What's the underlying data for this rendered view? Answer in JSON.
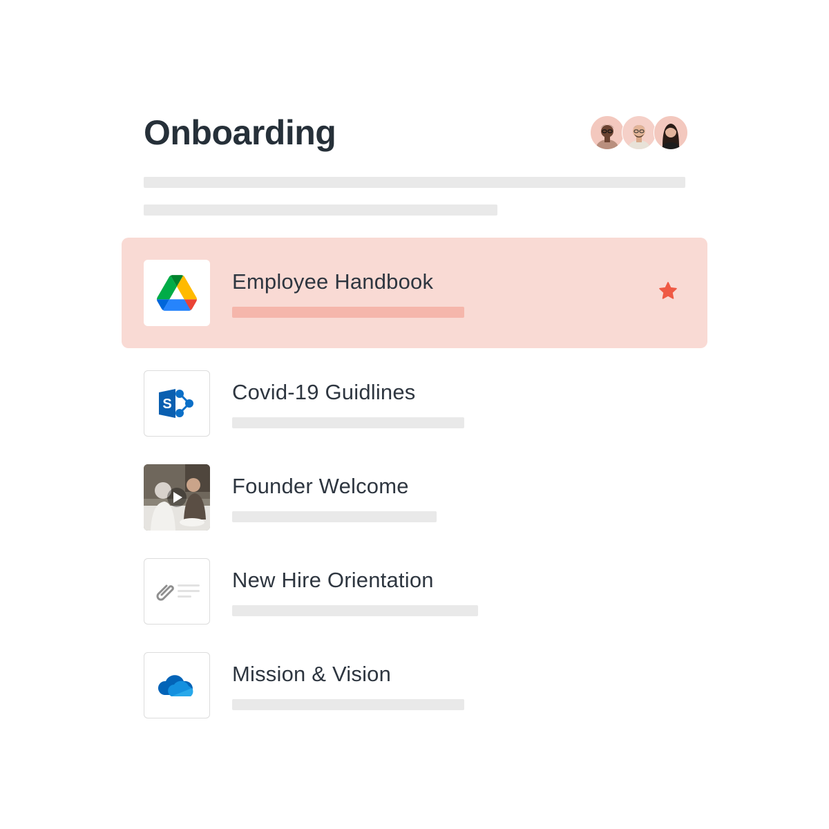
{
  "page": {
    "title": "Onboarding"
  },
  "collaborators": [
    {
      "name": "avatar-1",
      "bg": "#f3c8be"
    },
    {
      "name": "avatar-2",
      "bg": "#f5d0c8"
    },
    {
      "name": "avatar-3",
      "bg": "#f3c8be"
    }
  ],
  "items": [
    {
      "title": "Employee Handbook",
      "icon": "google-drive-icon",
      "starred": true,
      "bar_fraction": 0.4
    },
    {
      "title": "Covid-19 Guidlines",
      "icon": "sharepoint-icon",
      "starred": false
    },
    {
      "title": "Founder Welcome",
      "icon": "video-thumbnail-play-icon",
      "starred": false
    },
    {
      "title": "New Hire Orientation",
      "icon": "attachment-document-icon",
      "starred": false
    },
    {
      "title": "Mission & Vision",
      "icon": "onedrive-cloud-icon",
      "starred": false
    }
  ],
  "colors": {
    "highlight_bg": "#f9dad4",
    "highlight_bar": "#f5b6ab",
    "star": "#ef5a45",
    "skeleton": "#e9e9e9"
  }
}
